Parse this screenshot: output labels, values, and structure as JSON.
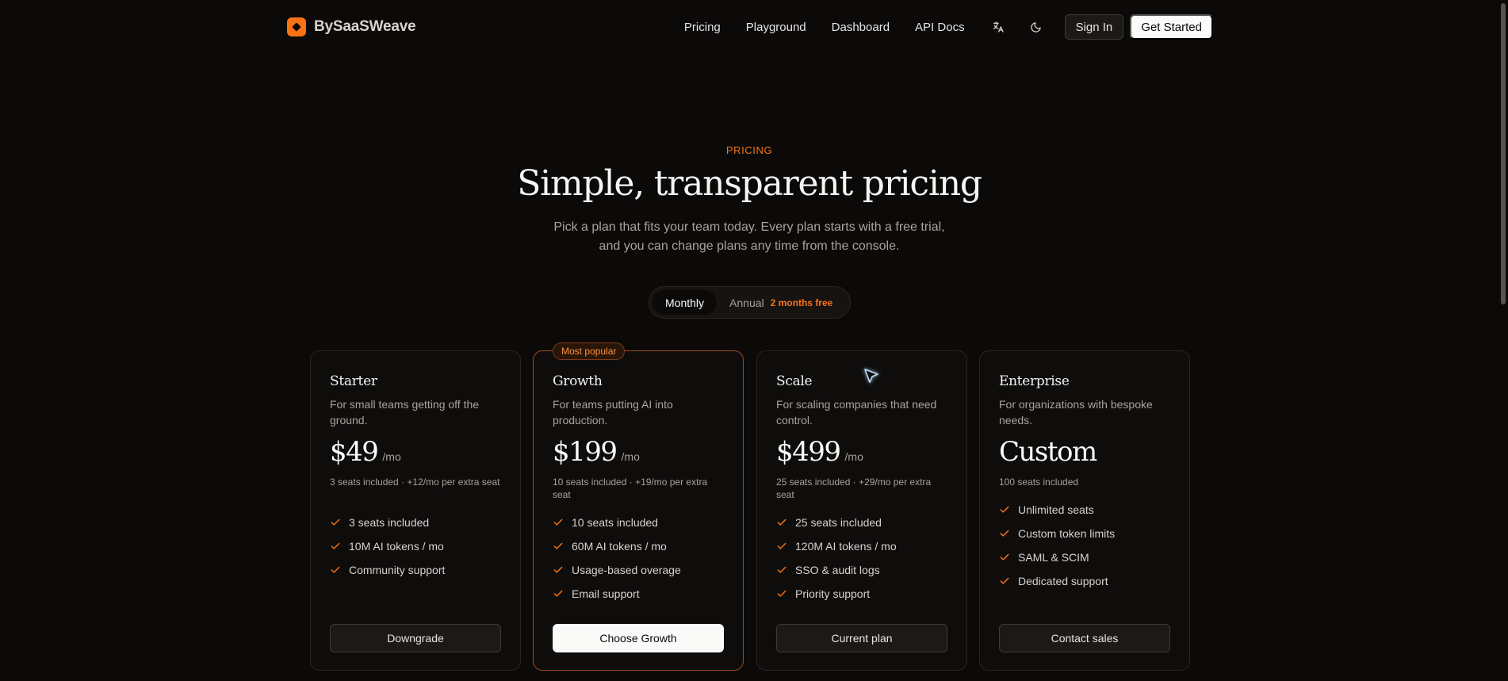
{
  "nav": {
    "brand": "BySaaSWeave",
    "links": [
      "Pricing",
      "Playground",
      "Dashboard",
      "API Docs"
    ],
    "sign_in": "Sign In",
    "get_started": "Get Started"
  },
  "hero": {
    "eyebrow": "PRICING",
    "title": "Simple, transparent pricing",
    "subtitle": "Pick a plan that fits your team today. Every plan starts with a free trial, and you can change plans any time from the console."
  },
  "billing_toggle": {
    "monthly": "Monthly",
    "annual": "Annual",
    "annual_badge": "2 months free"
  },
  "plans": [
    {
      "name": "Starter",
      "description": "For small teams getting off the ground.",
      "price": "$49",
      "unit": "/mo",
      "seats_note": "3 seats included · +12/mo per extra seat",
      "features": [
        "3 seats included",
        "10M AI tokens / mo",
        "Community support"
      ],
      "button": "Downgrade"
    },
    {
      "name": "Growth",
      "badge": "Most popular",
      "description": "For teams putting AI into production.",
      "price": "$199",
      "unit": "/mo",
      "seats_note": "10 seats included · +19/mo per extra seat",
      "features": [
        "10 seats included",
        "60M AI tokens / mo",
        "Usage-based overage",
        "Email support"
      ],
      "button": "Choose Growth"
    },
    {
      "name": "Scale",
      "description": "For scaling companies that need control.",
      "price": "$499",
      "unit": "/mo",
      "seats_note": "25 seats included · +29/mo per extra seat",
      "features": [
        "25 seats included",
        "120M AI tokens / mo",
        "SSO & audit logs",
        "Priority support"
      ],
      "button": "Current plan"
    },
    {
      "name": "Enterprise",
      "description": "For organizations with bespoke needs.",
      "price": "Custom",
      "unit": "",
      "seats_note": "100 seats included",
      "features": [
        "Unlimited seats",
        "Custom token limits",
        "SAML & SCIM",
        "Dedicated support"
      ],
      "button": "Contact sales"
    }
  ],
  "colors": {
    "accent": "#f97316",
    "background": "#0c0a09"
  },
  "icons": {
    "logo": "brand-logo-icon",
    "translate": "translate-icon",
    "theme": "moon-icon",
    "feature": "check-icon",
    "cursor": "cursor-arrow-icon"
  }
}
